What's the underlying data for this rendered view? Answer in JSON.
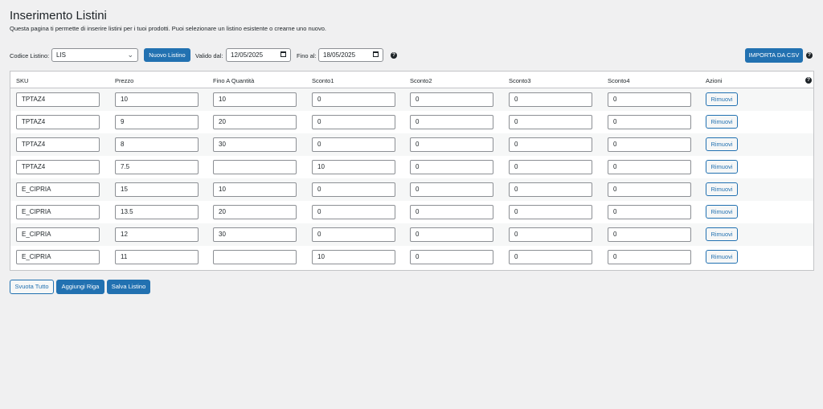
{
  "page": {
    "title": "Inserimento Listini",
    "description": "Questa pagina ti permette di inserire listini per i tuoi prodotti. Puoi selezionare un listino esistente o crearne uno nuovo."
  },
  "toolbar": {
    "codice_label": "Codice Listino:",
    "codice_value": "LIS",
    "nuovo_label": "Nuovo Listino",
    "valido_label": "Valido dal:",
    "valido_value": "12/05/2025",
    "fino_label": "Fino al:",
    "fino_value": "18/05/2025",
    "import_label": "IMPORTA DA CSV"
  },
  "table": {
    "headers": [
      "SKU",
      "Prezzo",
      "Fino A Quantità",
      "Sconto1",
      "Sconto2",
      "Sconto3",
      "Sconto4",
      "Azioni"
    ],
    "remove_label": "Rimuovi",
    "rows": [
      [
        "TPTAZ4",
        "10",
        "10",
        "0",
        "0",
        "0",
        "0"
      ],
      [
        "TPTAZ4",
        "9",
        "20",
        "0",
        "0",
        "0",
        "0"
      ],
      [
        "TPTAZ4",
        "8",
        "30",
        "0",
        "0",
        "0",
        "0"
      ],
      [
        "TPTAZ4",
        "7.5",
        "",
        "10",
        "0",
        "0",
        "0"
      ],
      [
        "E_CIPRIA",
        "15",
        "10",
        "0",
        "0",
        "0",
        "0"
      ],
      [
        "E_CIPRIA",
        "13.5",
        "20",
        "0",
        "0",
        "0",
        "0"
      ],
      [
        "E_CIPRIA",
        "12",
        "30",
        "0",
        "0",
        "0",
        "0"
      ],
      [
        "E_CIPRIA",
        "11",
        "",
        "10",
        "0",
        "0",
        "0"
      ]
    ]
  },
  "footer": {
    "svuota_label": "Svuota Tutto",
    "aggiungi_label": "Aggiungi Riga",
    "salva_label": "Salva Listino"
  },
  "icons": {
    "help": "help-circle-icon",
    "calendar": "calendar-icon",
    "dropdown": "chevron-down-icon"
  },
  "colors": {
    "primary": "#2271b1",
    "background": "#f0f0f1"
  }
}
